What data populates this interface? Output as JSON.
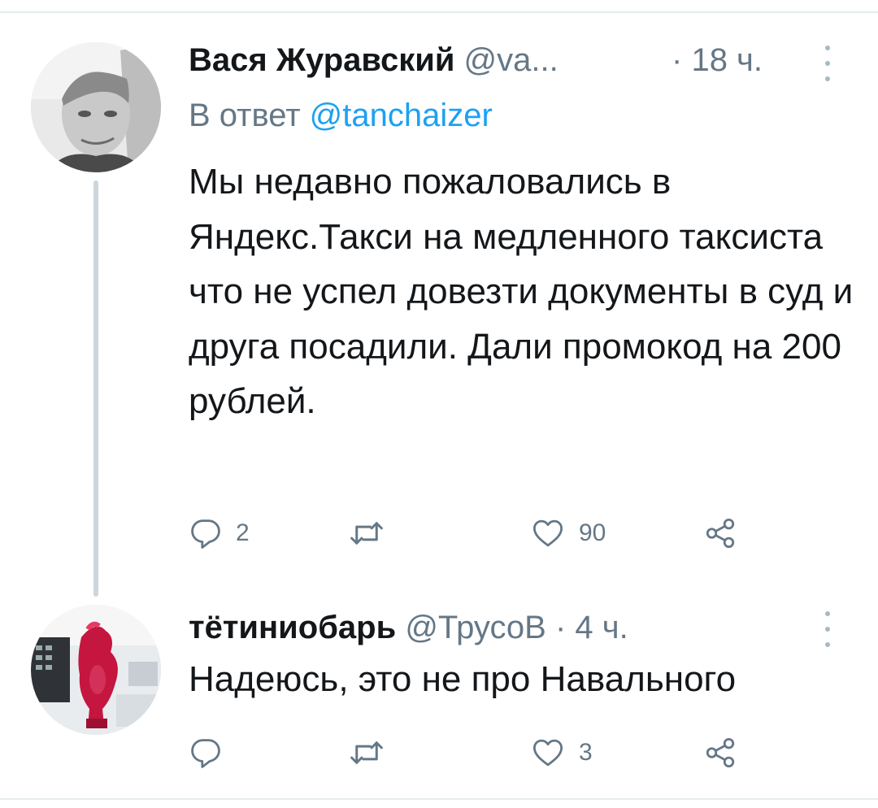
{
  "tweets": [
    {
      "display_name": "Вася Журавский",
      "handle": "@va...",
      "separator": "·",
      "time": "18 ч.",
      "reply_prefix": "В ответ",
      "reply_mention": "@tanchaizer",
      "text": "Мы недавно пожаловались в Яндекс.Такси на медленного таксиста что не успел довезти документы в суд и друга посадили. Дали промокод на 200 рублей.",
      "reply_count": "2",
      "retweet_count": "",
      "like_count": "90"
    },
    {
      "display_name": "тётиниобарь",
      "handle": "@ТрусоВ",
      "separator": "·",
      "time": "4 ч.",
      "text": "Надеюсь, это не про Навального",
      "reply_count": "",
      "retweet_count": "",
      "like_count": "3"
    }
  ],
  "icons": {
    "reply": "speech-bubble-icon",
    "retweet": "retweet-arrows-icon",
    "like": "heart-outline-icon",
    "share": "share-nodes-icon",
    "more": "vertical-dots-icon"
  },
  "colors": {
    "text_primary": "#14171a",
    "text_secondary": "#657786",
    "mention": "#1da1f2",
    "thread_line": "#ccd6dd"
  }
}
